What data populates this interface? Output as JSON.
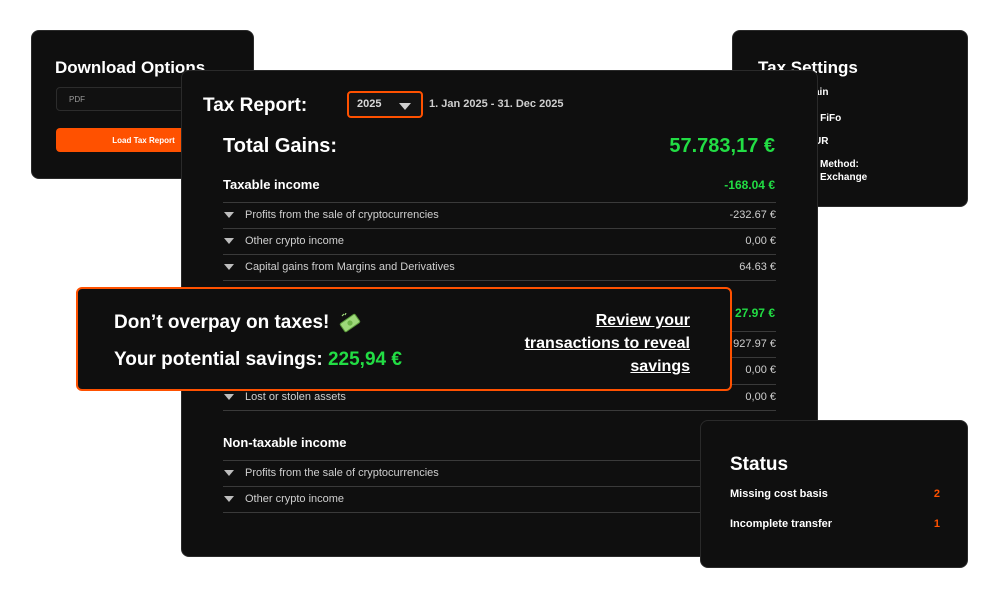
{
  "download": {
    "title": "Download Options",
    "format_value": "PDF",
    "load_button": "Load Tax Report"
  },
  "settings": {
    "title": "Tax Settings",
    "lines": [
      "ain",
      ": FiFo",
      "UR",
      "Method:",
      "Exchange"
    ]
  },
  "report": {
    "title": "Tax Report:",
    "year": "2025",
    "date_range": "1. Jan 2025 - 31. Dec 2025",
    "total_gains_label": "Total Gains:",
    "total_gains_value": "57.783,17 €",
    "taxable": {
      "label": "Taxable income",
      "value": "-168.04 €",
      "rows": [
        {
          "label": "Profits from the sale of cryptocurrencies",
          "value": "-232.67 €"
        },
        {
          "label": "Other crypto income",
          "value": "0,00 €"
        },
        {
          "label": "Capital gains from Margins and Derivatives",
          "value": "64.63 €"
        }
      ]
    },
    "second_section": {
      "value": "27.97 €",
      "rows": [
        {
          "label": "",
          "value": "927.97 €"
        },
        {
          "label": "",
          "value": "0,00 €"
        },
        {
          "label": "Lost or stolen assets",
          "value": "0,00 €"
        }
      ]
    },
    "non_taxable": {
      "label": "Non-taxable income",
      "rows": [
        {
          "label": "Profits from the sale of cryptocurrencies",
          "value": ""
        },
        {
          "label": "Other crypto income",
          "value": ""
        }
      ]
    }
  },
  "banner": {
    "headline": "Don’t overpay on taxes!",
    "savings_label": "Your potential savings:",
    "savings_value": "225,94 €",
    "cta": "Review your transactions to reveal savings"
  },
  "status": {
    "title": "Status",
    "items": [
      {
        "label": "Missing cost basis",
        "count": "2"
      },
      {
        "label": "Incomplete transfer",
        "count": "1"
      }
    ]
  },
  "colors": {
    "accent": "#ff5100",
    "positive": "#22dd44",
    "panel": "#0f0f0f"
  }
}
